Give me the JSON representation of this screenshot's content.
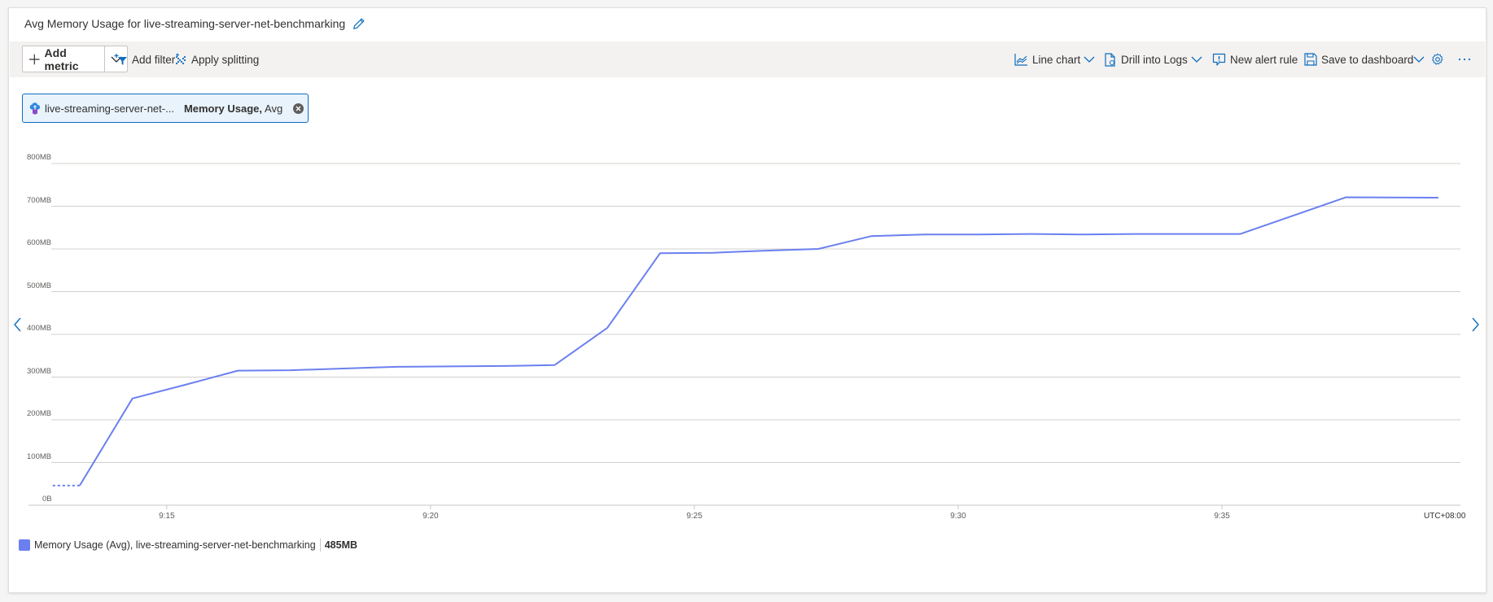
{
  "header": {
    "title": "Avg Memory Usage for live-streaming-server-net-benchmarking",
    "edit_icon": "pencil-icon"
  },
  "toolbar": {
    "add_metric_label": "Add metric",
    "add_filter_label": "Add filter",
    "apply_splitting_label": "Apply splitting",
    "line_chart_label": "Line chart",
    "drill_into_logs_label": "Drill into Logs",
    "new_alert_rule_label": "New alert rule",
    "save_to_dashboard_label": "Save to dashboard",
    "settings_icon": "gear-icon",
    "more_icon": "ellipsis-icon"
  },
  "metric_chip": {
    "resource": "live-streaming-server-net-...",
    "metric": "Memory Usage,",
    "aggregation": "Avg"
  },
  "legend": {
    "label": "Memory Usage (Avg), live-streaming-server-net-benchmarking",
    "value": "485MB",
    "color": "#6b7ff0"
  },
  "colors": {
    "accent": "#0f6cbd",
    "series": "#6b7ff0"
  },
  "chart_data": {
    "type": "line",
    "title": "Avg Memory Usage for live-streaming-server-net-benchmarking",
    "xlabel": "",
    "ylabel": "",
    "timezone": "UTC+08:00",
    "x_unit": "minutes after 9:00",
    "xlim": [
      12.38,
      39.52
    ],
    "ylim": [
      0,
      800
    ],
    "y_unit": "MB",
    "grid": true,
    "legend_position": "bottom-left",
    "y_ticks": [
      {
        "value": 0,
        "label": "0B"
      },
      {
        "value": 100,
        "label": "100MB"
      },
      {
        "value": 200,
        "label": "200MB"
      },
      {
        "value": 300,
        "label": "300MB"
      },
      {
        "value": 400,
        "label": "400MB"
      },
      {
        "value": 500,
        "label": "500MB"
      },
      {
        "value": 600,
        "label": "600MB"
      },
      {
        "value": 700,
        "label": "700MB"
      },
      {
        "value": 800,
        "label": "800MB"
      }
    ],
    "x_ticks": [
      {
        "value": 15,
        "label": "9:15"
      },
      {
        "value": 20,
        "label": "9:20"
      },
      {
        "value": 25,
        "label": "9:25"
      },
      {
        "value": 30,
        "label": "9:30"
      },
      {
        "value": 35,
        "label": "9:35"
      }
    ],
    "dashed_segment": {
      "x": [
        12.84,
        13.35
      ],
      "y": [
        46,
        46
      ]
    },
    "series": [
      {
        "name": "Memory Usage (Avg), live-streaming-server-net-benchmarking",
        "color": "#6b7ff0",
        "x": [
          13.35,
          14.35,
          15.35,
          16.35,
          17.35,
          18.35,
          19.35,
          20.35,
          21.35,
          22.35,
          23.35,
          24.35,
          25.35,
          26.35,
          27.35,
          28.35,
          29.35,
          30.35,
          31.35,
          32.35,
          33.35,
          34.35,
          35.35,
          36.35,
          37.35,
          39.1
        ],
        "values": [
          46,
          250,
          282,
          315,
          316,
          320,
          324,
          325,
          326,
          328,
          415,
          590,
          591,
          596,
          600,
          630,
          634,
          634,
          635,
          634,
          635,
          635,
          635,
          678,
          721,
          720
        ]
      }
    ]
  }
}
